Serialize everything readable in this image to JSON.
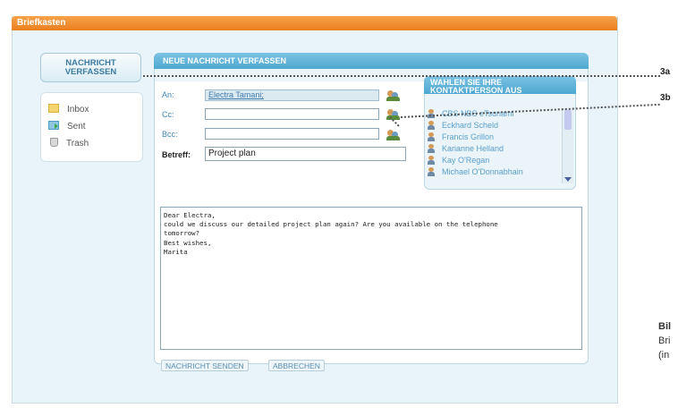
{
  "window": {
    "title": "Briefkasten"
  },
  "sidebar": {
    "compose_label": "NACHRICHT\nVERFASSEN",
    "folders": [
      {
        "label": "Inbox",
        "icon": "inbox-icon"
      },
      {
        "label": "Sent",
        "icon": "sent-icon"
      },
      {
        "label": "Trash",
        "icon": "trash-icon"
      }
    ]
  },
  "compose": {
    "header": "NEUE NACHRICHT VERFASSEN",
    "to_label": "An:",
    "to_value": "Electra Tamani;",
    "cc_label": "Cc:",
    "cc_value": "",
    "bcc_label": "Bcc:",
    "bcc_value": "",
    "subject_label": "Betreff:",
    "subject_value": "Project plan",
    "body": "Dear Electra,\ncould we discuss our detailed project plan again? Are you available on the telephone\ntomorrow?\nBest wishes,\nMarita",
    "send_label": "NACHRICHT SENDEN",
    "cancel_label": "ABBRECHEN"
  },
  "contacts": {
    "header": "WAHLEN SIE IHRE KONTAKTPERSON AUS",
    "items": [
      "CBS NBS eTsunami",
      "Eckhard Scheld",
      "Francis Grillon",
      "Karianne Helland",
      "Kay O'Regan",
      "Michael O'Donnabhain"
    ]
  },
  "callouts": {
    "a": "3a",
    "b": "3b"
  },
  "side_caption": {
    "line1": "Bil",
    "line2": "Bri",
    "line3": "(in"
  },
  "colors": {
    "title_bar": "#ea7f1e",
    "panel_header": "#4da7d1",
    "link": "#3d7bb0"
  }
}
